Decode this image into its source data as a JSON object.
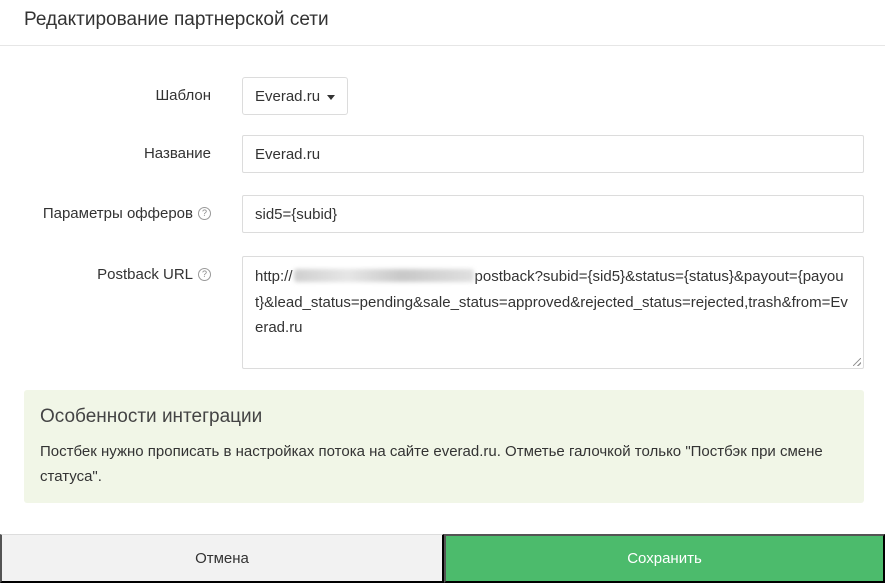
{
  "modal": {
    "title": "Редактирование партнерской сети"
  },
  "form": {
    "template": {
      "label": "Шаблон",
      "value": "Everad.ru"
    },
    "name": {
      "label": "Название",
      "value": "Everad.ru"
    },
    "offer_params": {
      "label": "Параметры офферов",
      "value": "sid5={subid}"
    },
    "postback_url": {
      "label": "Postback URL",
      "value_prefix": "http://",
      "value_suffix": "postback?subid={sid5}&status={status}&payout={payout}&lead_status=pending&sale_status=approved&rejected_status=rejected,trash&from=Everad.ru"
    }
  },
  "info": {
    "title": "Особенности интеграции",
    "text": "Постбек нужно прописать в настройках потока на сайте everad.ru. Отметье галочкой только \"Постбэк при смене статуса\"."
  },
  "footer": {
    "cancel_label": "Отмена",
    "save_label": "Сохранить"
  },
  "colors": {
    "save_button": "#4cbb6c",
    "info_panel_bg": "#f1f6e7",
    "cancel_button_bg": "#f2f2f2"
  },
  "icons": {
    "help": "question-circle-icon",
    "dropdown": "caret-down-icon"
  }
}
